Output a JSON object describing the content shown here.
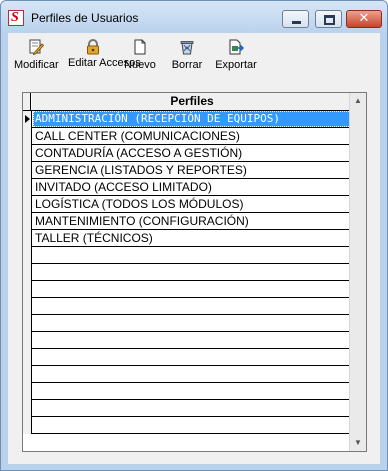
{
  "window": {
    "title": "Perfiles de Usuarios",
    "controls": {
      "minimize": "minimize",
      "maximize": "maximize",
      "close": "close"
    }
  },
  "toolbar": {
    "items": [
      {
        "label": "Modificar",
        "icon": "edit-pencil-icon"
      },
      {
        "label": "Editar Accesos",
        "icon": "lock-icon"
      },
      {
        "label": "Nuevo",
        "icon": "new-document-icon"
      },
      {
        "label": "Borrar",
        "icon": "recycle-bin-icon"
      },
      {
        "label": "Exportar",
        "icon": "export-icon"
      }
    ]
  },
  "grid": {
    "column": "Perfiles",
    "rows": [
      "ADMINISTRACIÓN (RECEPCIÓN DE EQUIPOS)",
      "CALL CENTER (COMUNICACIONES)",
      "CONTADURÍA (ACCESO A GESTIÓN)",
      "GERENCIA (LISTADOS Y REPORTES)",
      "INVITADO (ACCESO LIMITADO)",
      "LOGÍSTICA (TODOS LOS MÓDULOS)",
      "MANTENIMIENTO (CONFIGURACIÓN)",
      "TALLER (TÉCNICOS)"
    ],
    "selected_index": 0,
    "empty_rows": 11
  },
  "colors": {
    "selection": "#3399ff",
    "titlebar": "#bad2ec",
    "close_button": "#c8432b"
  }
}
